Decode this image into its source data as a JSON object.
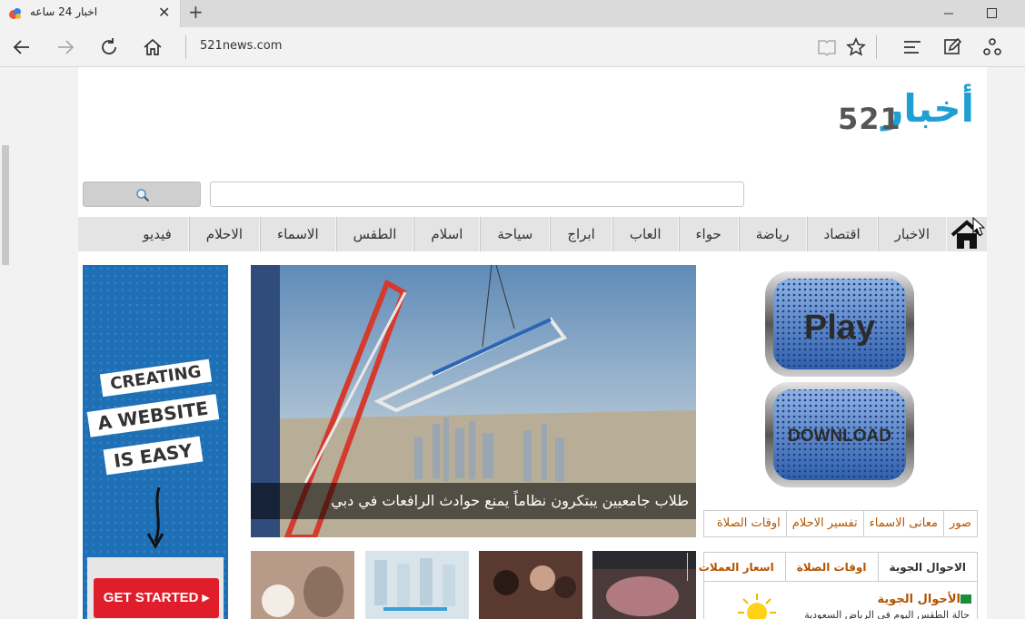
{
  "browser": {
    "tab_title": "اخبار 24 ساعه",
    "address": "521news.com"
  },
  "site": {
    "logo_arabic": "أخبار",
    "logo_number": "521",
    "menu": [
      "الاخبار",
      "اقتصاد",
      "رياضة",
      "حواء",
      "العاب",
      "ابراج",
      "سياحة",
      "اسلام",
      "الطقس",
      "الاسماء",
      "الاحلام",
      "فيديو"
    ]
  },
  "ad": {
    "line1": "CREATING",
    "line2": "A WEBSITE",
    "line3": "IS EASY",
    "cta": "GET STARTED ▸"
  },
  "hero": {
    "caption": "طلاب جامعيين يبتكرون نظاماً يمنع حوادث الرافعات في دبي"
  },
  "sidebar": {
    "play_label": "Play",
    "download_label": "DOWNLOAD",
    "links": [
      "صور",
      "معانى الاسماء",
      "تفسير الاحلام",
      "اوقات الصلاة"
    ],
    "widget_tabs": [
      "الاحوال الجوية",
      "اوقات الصلاة",
      "اسعار العملات"
    ],
    "weather_title": "الأحوال الجوية",
    "weather_sub": "حالة الطقس اليوم في الرياض السعودية"
  },
  "colors": {
    "logo_blue": "#1fa0d5",
    "link_orange": "#b35400",
    "ad_blue": "#1f6fb5",
    "cta_red": "#e01e2b"
  }
}
